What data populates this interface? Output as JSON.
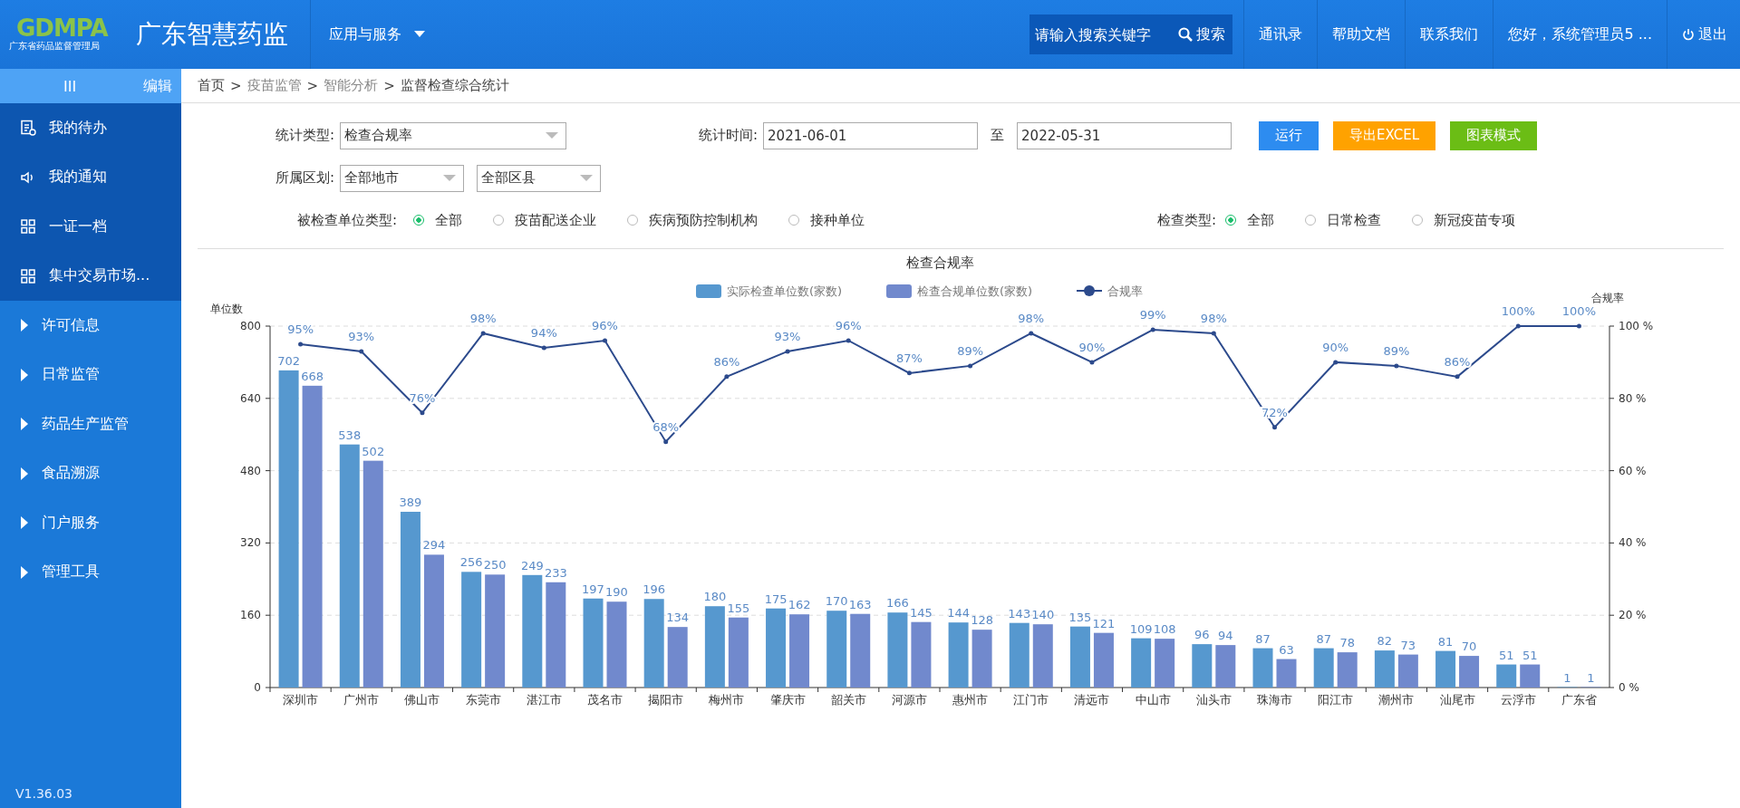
{
  "header": {
    "logo_text": "GDMPA",
    "logo_subtitle": "广东省药品监督管理局",
    "title": "广东智慧药监",
    "menu": "应用与服务",
    "search": {
      "placeholder": "请输入搜索关键字",
      "button": "搜索"
    },
    "links": [
      "通讯录",
      "帮助文档",
      "联系我们",
      "您好，系统管理员5 ..."
    ],
    "logout": "退出"
  },
  "sidebar": {
    "toggle": "III",
    "edit": "编辑",
    "items": [
      {
        "kind": "task",
        "label": "我的待办"
      },
      {
        "kind": "notice",
        "label": "我的通知"
      },
      {
        "kind": "grid",
        "label": "一证一档"
      },
      {
        "kind": "grid",
        "label": "集中交易市场..."
      },
      {
        "kind": "group",
        "label": "许可信息"
      },
      {
        "kind": "group",
        "label": "日常监管"
      },
      {
        "kind": "group",
        "label": "药品生产监管"
      },
      {
        "kind": "group",
        "label": "食品溯源"
      },
      {
        "kind": "group",
        "label": "门户服务"
      },
      {
        "kind": "group",
        "label": "管理工具"
      }
    ],
    "version": "V1.36.03"
  },
  "breadcrumb_separator": ">",
  "breadcrumb": [
    {
      "label": "首页",
      "kind": "current"
    },
    {
      "label": "疫苗监管",
      "kind": "muted"
    },
    {
      "label": "智能分析",
      "kind": "muted"
    },
    {
      "label": "监督检查综合统计",
      "kind": "current"
    }
  ],
  "filters": {
    "stat_type": {
      "label": "统计类型:",
      "value": "检查合规率"
    },
    "stat_time": {
      "label": "统计时间:",
      "from": "2021-06-01",
      "sep": "至",
      "to": "2022-05-31"
    },
    "buttons": [
      {
        "label": "运行",
        "color": "#2d8cf0"
      },
      {
        "label": "导出EXCEL",
        "color": "#ffa200"
      },
      {
        "label": "图表模式",
        "color": "#6bbd15"
      }
    ],
    "region": {
      "label": "所属区划:",
      "city": "全部地市",
      "county": "全部区县"
    },
    "unit_type": {
      "label": "被检查单位类型:",
      "options": [
        {
          "label": "全部",
          "selected": true
        },
        {
          "label": "疫苗配送企业",
          "selected": false
        },
        {
          "label": "疾病预防控制机构",
          "selected": false
        },
        {
          "label": "接种单位",
          "selected": false
        }
      ]
    },
    "check_type": {
      "label": "检查类型:",
      "options": [
        {
          "label": "全部",
          "selected": true
        },
        {
          "label": "日常检查",
          "selected": false
        },
        {
          "label": "新冠疫苗专项",
          "selected": false
        }
      ]
    }
  },
  "chart_data": {
    "type": "bar",
    "title": "检查合规率",
    "ylabel": "单位数",
    "y2label": "合规率",
    "categories": [
      "深圳市",
      "广州市",
      "佛山市",
      "东莞市",
      "湛江市",
      "茂名市",
      "揭阳市",
      "梅州市",
      "肇庆市",
      "韶关市",
      "河源市",
      "惠州市",
      "江门市",
      "清远市",
      "中山市",
      "汕头市",
      "珠海市",
      "阳江市",
      "潮州市",
      "汕尾市",
      "云浮市",
      "广东省"
    ],
    "series": [
      {
        "name": "实际检查单位数(家数)",
        "color": "#5698cf",
        "values": [
          702,
          538,
          389,
          256,
          249,
          197,
          196,
          180,
          175,
          170,
          166,
          144,
          143,
          135,
          109,
          96,
          87,
          87,
          82,
          81,
          51,
          1
        ]
      },
      {
        "name": "检查合规单位数(家数)",
        "color": "#7189cd",
        "values": [
          668,
          502,
          294,
          250,
          233,
          190,
          134,
          155,
          162,
          163,
          145,
          128,
          140,
          121,
          108,
          94,
          63,
          78,
          73,
          70,
          51,
          1
        ]
      },
      {
        "name": "合规率",
        "color": "#2c4a8c",
        "type": "line",
        "axis": "y2",
        "values": [
          95,
          93,
          76,
          98,
          94,
          96,
          68,
          86,
          93,
          96,
          87,
          89,
          98,
          90,
          99,
          98,
          72,
          90,
          89,
          86,
          100,
          100
        ],
        "value_labels": [
          "95%",
          "93%",
          "76%",
          "98%",
          "94%",
          "96%",
          "68%",
          "86%",
          "93%",
          "96%",
          "87%",
          "89%",
          "98%",
          "90%",
          "99%",
          "98%",
          "72%",
          "90%",
          "89%",
          "86%",
          "100%",
          "100%"
        ]
      }
    ],
    "y2lim": [
      0,
      100
    ],
    "grid": true,
    "legend": "top",
    "ylim": [
      0,
      800
    ],
    "yticks": [
      0,
      160,
      320,
      480,
      640,
      800
    ],
    "y2ticks": [
      {
        "value": 0,
        "label": "0 %"
      },
      {
        "value": 20,
        "label": "20 %"
      },
      {
        "value": 40,
        "label": "40 %"
      },
      {
        "value": 60,
        "label": "60 %"
      },
      {
        "value": 80,
        "label": "80 %"
      },
      {
        "value": 100,
        "label": "100 %"
      }
    ],
    "data_labels": true
  }
}
